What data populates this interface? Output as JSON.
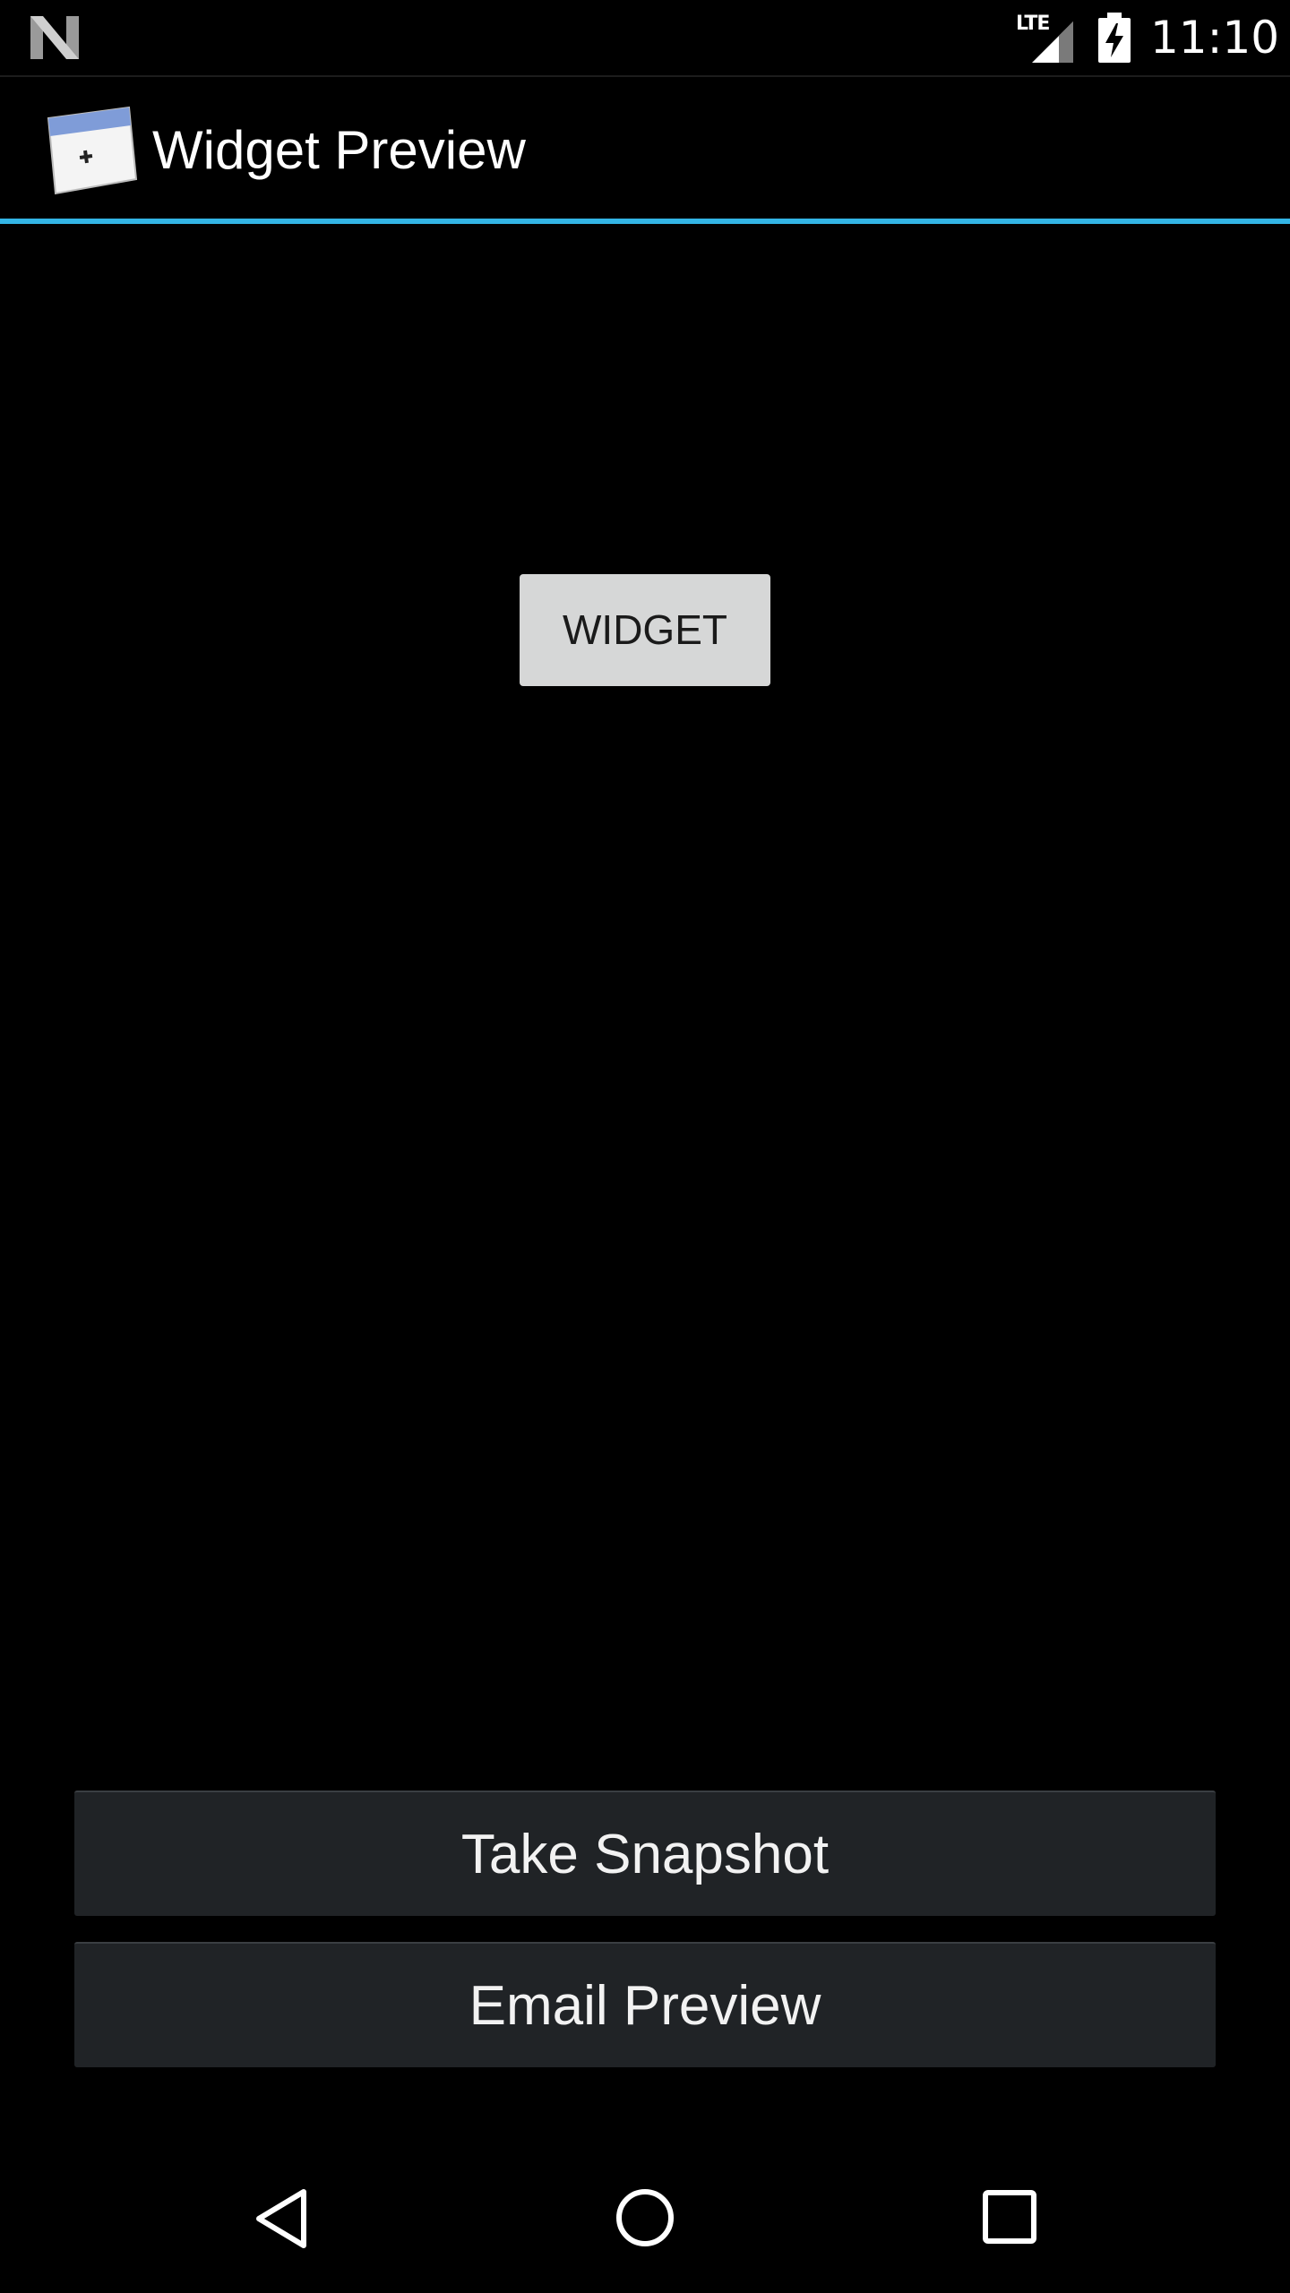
{
  "status_bar": {
    "network_label": "LTE",
    "time": "11:10",
    "icons": [
      "n-logo-icon",
      "signal-icon",
      "battery-charging-icon"
    ]
  },
  "action_bar": {
    "app_icon": "widget-preview-app-icon",
    "title": "Widget Preview",
    "divider_color": "#33b5e5"
  },
  "main": {
    "widget_button_label": "WIDGET"
  },
  "bottom_buttons": {
    "take_snapshot_label": "Take Snapshot",
    "email_preview_label": "Email Preview"
  },
  "nav_bar": {
    "icons": [
      "back-icon",
      "home-icon",
      "recents-icon"
    ]
  },
  "colors": {
    "background": "#000000",
    "accent": "#33b5e5",
    "widget_button_bg": "#d6d7d7",
    "wide_button_bg": "#202326"
  }
}
